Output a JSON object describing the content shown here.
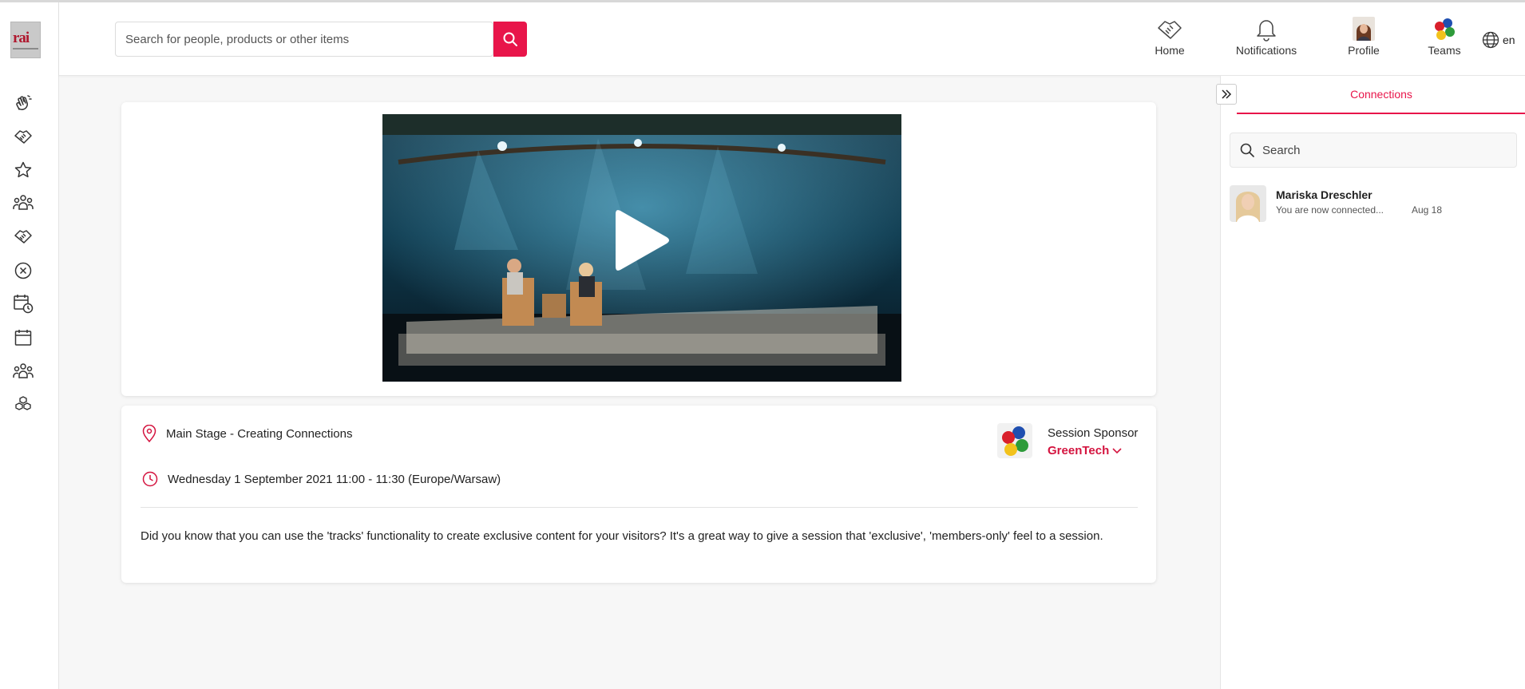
{
  "header": {
    "search_placeholder": "Search for people, products or other items",
    "nav": {
      "home": "Home",
      "notifications": "Notifications",
      "profile": "Profile",
      "teams": "Teams"
    },
    "language": "en"
  },
  "sidebar": {
    "logo_text": "rai",
    "icons": [
      "hand-wave-icon",
      "handshake-icon",
      "star-icon",
      "people-icon",
      "handshake-icon",
      "cancel-icon",
      "calendar-clock-icon",
      "calendar-icon",
      "people-icon",
      "cubes-icon"
    ]
  },
  "session": {
    "location": "Main Stage - Creating Connections",
    "datetime": "Wednesday 1 September 2021 11:00 - 11:30 (Europe/Warsaw)",
    "sponsor_label": "Session Sponsor",
    "sponsor_name": "GreenTech",
    "description": "Did you know that you can use the 'tracks' functionality to create exclusive content for your visitors? It's a great way to give a session that 'exclusive', 'members-only' feel to a session."
  },
  "right_panel": {
    "tab": "Connections",
    "search_placeholder": "Search",
    "connections": [
      {
        "name": "Mariska Dreschler",
        "message": "You are now connected...",
        "date": "Aug 18"
      }
    ]
  },
  "colors": {
    "accent": "#e8154a",
    "sponsor": "#d4143f"
  }
}
